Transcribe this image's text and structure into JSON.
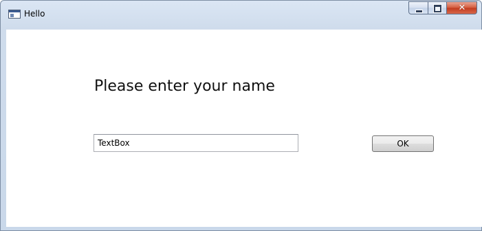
{
  "window": {
    "title": "Hello",
    "icon": "window-app-icon",
    "caption_buttons": {
      "minimize_icon": "minimize-icon",
      "maximize_icon": "maximize-icon",
      "close_glyph": "✕",
      "close_color": "#c7421f"
    }
  },
  "form": {
    "prompt": "Please enter your name",
    "name_input_value": "TextBox",
    "ok_label": "OK"
  }
}
